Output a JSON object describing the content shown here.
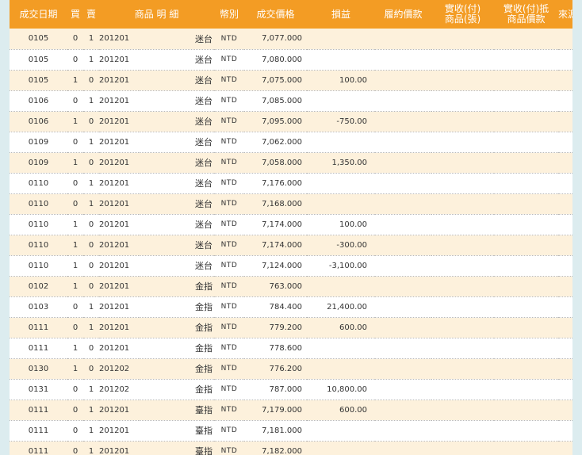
{
  "columns": {
    "date": "成交日期",
    "buy": "買",
    "sell": "賣",
    "product": "商品 明 細",
    "currency": "幣別",
    "price": "成交價格",
    "pl": "損益",
    "settle": "履約價款",
    "recv_units_l1": "實收(付)",
    "recv_units_l2": "商品(張)",
    "recv_amt_l1": "實收(付)抵",
    "recv_amt_l2": "商品價款",
    "source": "來源"
  },
  "rows": [
    {
      "date": "0105",
      "buy": "0",
      "sell": "1",
      "month": "201201",
      "name": "迷台",
      "cur": "NTD",
      "price": "7,077.000",
      "pl": ""
    },
    {
      "date": "0105",
      "buy": "0",
      "sell": "1",
      "month": "201201",
      "name": "迷台",
      "cur": "NTD",
      "price": "7,080.000",
      "pl": ""
    },
    {
      "date": "0105",
      "buy": "1",
      "sell": "0",
      "month": "201201",
      "name": "迷台",
      "cur": "NTD",
      "price": "7,075.000",
      "pl": "100.00"
    },
    {
      "date": "0106",
      "buy": "0",
      "sell": "1",
      "month": "201201",
      "name": "迷台",
      "cur": "NTD",
      "price": "7,085.000",
      "pl": ""
    },
    {
      "date": "0106",
      "buy": "1",
      "sell": "0",
      "month": "201201",
      "name": "迷台",
      "cur": "NTD",
      "price": "7,095.000",
      "pl": "-750.00"
    },
    {
      "date": "0109",
      "buy": "0",
      "sell": "1",
      "month": "201201",
      "name": "迷台",
      "cur": "NTD",
      "price": "7,062.000",
      "pl": ""
    },
    {
      "date": "0109",
      "buy": "1",
      "sell": "0",
      "month": "201201",
      "name": "迷台",
      "cur": "NTD",
      "price": "7,058.000",
      "pl": "1,350.00"
    },
    {
      "date": "0110",
      "buy": "0",
      "sell": "1",
      "month": "201201",
      "name": "迷台",
      "cur": "NTD",
      "price": "7,176.000",
      "pl": ""
    },
    {
      "date": "0110",
      "buy": "0",
      "sell": "1",
      "month": "201201",
      "name": "迷台",
      "cur": "NTD",
      "price": "7,168.000",
      "pl": ""
    },
    {
      "date": "0110",
      "buy": "1",
      "sell": "0",
      "month": "201201",
      "name": "迷台",
      "cur": "NTD",
      "price": "7,174.000",
      "pl": "100.00"
    },
    {
      "date": "0110",
      "buy": "1",
      "sell": "0",
      "month": "201201",
      "name": "迷台",
      "cur": "NTD",
      "price": "7,174.000",
      "pl": "-300.00"
    },
    {
      "date": "0110",
      "buy": "1",
      "sell": "0",
      "month": "201201",
      "name": "迷台",
      "cur": "NTD",
      "price": "7,124.000",
      "pl": "-3,100.00"
    },
    {
      "date": "0102",
      "buy": "1",
      "sell": "0",
      "month": "201201",
      "name": "金指",
      "cur": "NTD",
      "price": "763.000",
      "pl": ""
    },
    {
      "date": "0103",
      "buy": "0",
      "sell": "1",
      "month": "201201",
      "name": "金指",
      "cur": "NTD",
      "price": "784.400",
      "pl": "21,400.00"
    },
    {
      "date": "0111",
      "buy": "0",
      "sell": "1",
      "month": "201201",
      "name": "金指",
      "cur": "NTD",
      "price": "779.200",
      "pl": "600.00"
    },
    {
      "date": "0111",
      "buy": "1",
      "sell": "0",
      "month": "201201",
      "name": "金指",
      "cur": "NTD",
      "price": "778.600",
      "pl": ""
    },
    {
      "date": "0130",
      "buy": "1",
      "sell": "0",
      "month": "201202",
      "name": "金指",
      "cur": "NTD",
      "price": "776.200",
      "pl": ""
    },
    {
      "date": "0131",
      "buy": "0",
      "sell": "1",
      "month": "201202",
      "name": "金指",
      "cur": "NTD",
      "price": "787.000",
      "pl": "10,800.00"
    },
    {
      "date": "0111",
      "buy": "0",
      "sell": "1",
      "month": "201201",
      "name": "臺指",
      "cur": "NTD",
      "price": "7,179.000",
      "pl": "600.00"
    },
    {
      "date": "0111",
      "buy": "0",
      "sell": "1",
      "month": "201201",
      "name": "臺指",
      "cur": "NTD",
      "price": "7,181.000",
      "pl": ""
    },
    {
      "date": "0111",
      "buy": "0",
      "sell": "1",
      "month": "201201",
      "name": "臺指",
      "cur": "NTD",
      "price": "7,182.000",
      "pl": ""
    }
  ],
  "colors": {
    "header_bg": "#f39c24",
    "row_odd": "#fdf1dc",
    "row_even": "#ffffff",
    "page_bg": "#dcecef"
  }
}
